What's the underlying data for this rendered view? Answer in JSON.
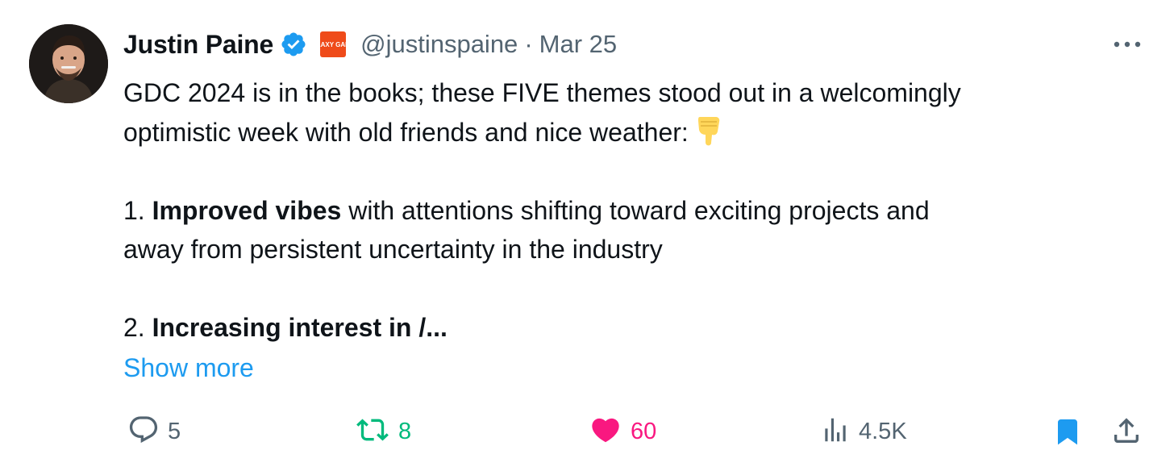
{
  "author": {
    "name": "Justin Paine",
    "handle": "@justinspaine",
    "separator": "·",
    "date": "Mar 25",
    "affiliate_badge": "GALAXY GAMES",
    "verified_color": "#1d9bf0"
  },
  "tweet": {
    "line1": "GDC 2024 is in the books; these FIVE themes stood out in a welcomingly",
    "line2": "optimistic week with old friends and nice weather:",
    "emoji": "pointing-down-hand",
    "item1_number": "1.",
    "item1_bold": "Improved vibes",
    "item1_rest": "with attentions shifting toward exciting projects and",
    "item1_line2": "away from persistent uncertainty in the industry",
    "item2_number": "2.",
    "item2_bold": "Increasing interest in /...",
    "show_more": "Show more"
  },
  "actions": {
    "replies": "5",
    "retweets": "8",
    "likes": "60",
    "views": "4.5K"
  },
  "colors": {
    "text": "#0f1419",
    "muted": "#536471",
    "link": "#1d9bf0",
    "retweet": "#00ba7c",
    "like": "#f91880"
  }
}
